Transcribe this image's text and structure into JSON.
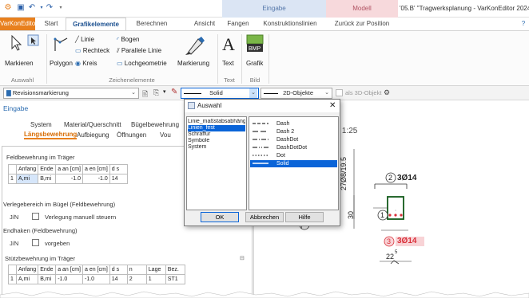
{
  "titlebar": {
    "window_title": "'05.B' \"Tragwerksplanung - VarKonEditor 2024\"",
    "contextual_1": "Eingabe",
    "contextual_2": "Modell"
  },
  "tabs": [
    "VarKonEditor",
    "Start",
    "Grafikelemente",
    "Berechnen",
    "Ansicht",
    "Fangen",
    "Konstruktionslinien",
    "Zurück zur Position"
  ],
  "ribbon": {
    "auswahl": {
      "label": "Auswahl",
      "markieren": "Markieren"
    },
    "zeichen": {
      "label": "Zeichenelemente",
      "linie": "Linie",
      "bogen": "Bogen",
      "rechteck": "Rechteck",
      "parallele": "Parallele Linie",
      "polygon": "Polygon",
      "kreis": "Kreis",
      "lochgeometrie": "Lochgeometrie",
      "markierung": "Markierung"
    },
    "text": {
      "label": "Text",
      "btn": "Text"
    },
    "bild": {
      "label": "Bild",
      "btn": "Grafik",
      "bmp": "BMP"
    }
  },
  "toolbar": {
    "layer": "Revisionsmarkierung",
    "linestyle": "Solid",
    "objects": "2D-Objekte",
    "as3d": "als 3D-Objekt"
  },
  "panel": {
    "title": "Eingabe",
    "nav_row1": [
      "System",
      "Material/Querschnitt",
      "Bügelbewehrung"
    ],
    "nav_row2": [
      "Längsbewehrung",
      "Aufbiegung",
      "Öffnungen",
      "Vou"
    ],
    "feld_title": "Feldbewehrung im Träger",
    "cols": [
      "Anfang",
      "Ende",
      "a an [cm]",
      "a en [cm]",
      "d s"
    ],
    "row1": [
      "1",
      "A,mi",
      "B,mi",
      "-1.0",
      "-1.0",
      "14"
    ],
    "verlege_title": "Verlegebereich im Bügel (Feldbewehrung)",
    "jn": "J/N",
    "verlege_cb": "Verlegung manuell steuern",
    "endhaken_title": "Endhaken (Feldbewehrung)",
    "endhaken_cb": "vorgeben",
    "stuetz_title": "Stützbewehrung im Träger",
    "cols2": [
      "Anfang",
      "Ende",
      "a an [cm]",
      "a en [cm]",
      "d s",
      "n",
      "Lage",
      "Bez."
    ],
    "row2": [
      "1",
      "A,mi",
      "B,mi",
      "-1.0",
      "-1.0",
      "14",
      "2",
      "1",
      "ST1"
    ]
  },
  "dialog": {
    "title": "Auswahl",
    "left_items": [
      "Linie_maßstabsabhängig",
      "Linien_fest",
      "Schraffur",
      "Symbole",
      "System"
    ],
    "left_selected": 1,
    "right_items": [
      "Dash",
      "Dash 2",
      "DashDot",
      "DashDotDot",
      "Dot",
      "Solid"
    ],
    "right_selected": 5,
    "ok": "OK",
    "cancel": "Abbrechen",
    "help": "Hilfe"
  },
  "drawing": {
    "scale": "A 1:25",
    "dim_vertical": "27Ø8/19.5",
    "label2": "2",
    "label2_txt": "3Ø14",
    "label3": "3",
    "label3_txt": "3Ø14",
    "label1": "1",
    "dim30": "30",
    "dim22": "22",
    "dim22_sup": "5",
    "bottom_txt": "1B"
  },
  "colors": {
    "accent": "#e8801e",
    "blue": "#2a6bb0",
    "red": "#d9303a",
    "green": "#2e9a3a"
  }
}
